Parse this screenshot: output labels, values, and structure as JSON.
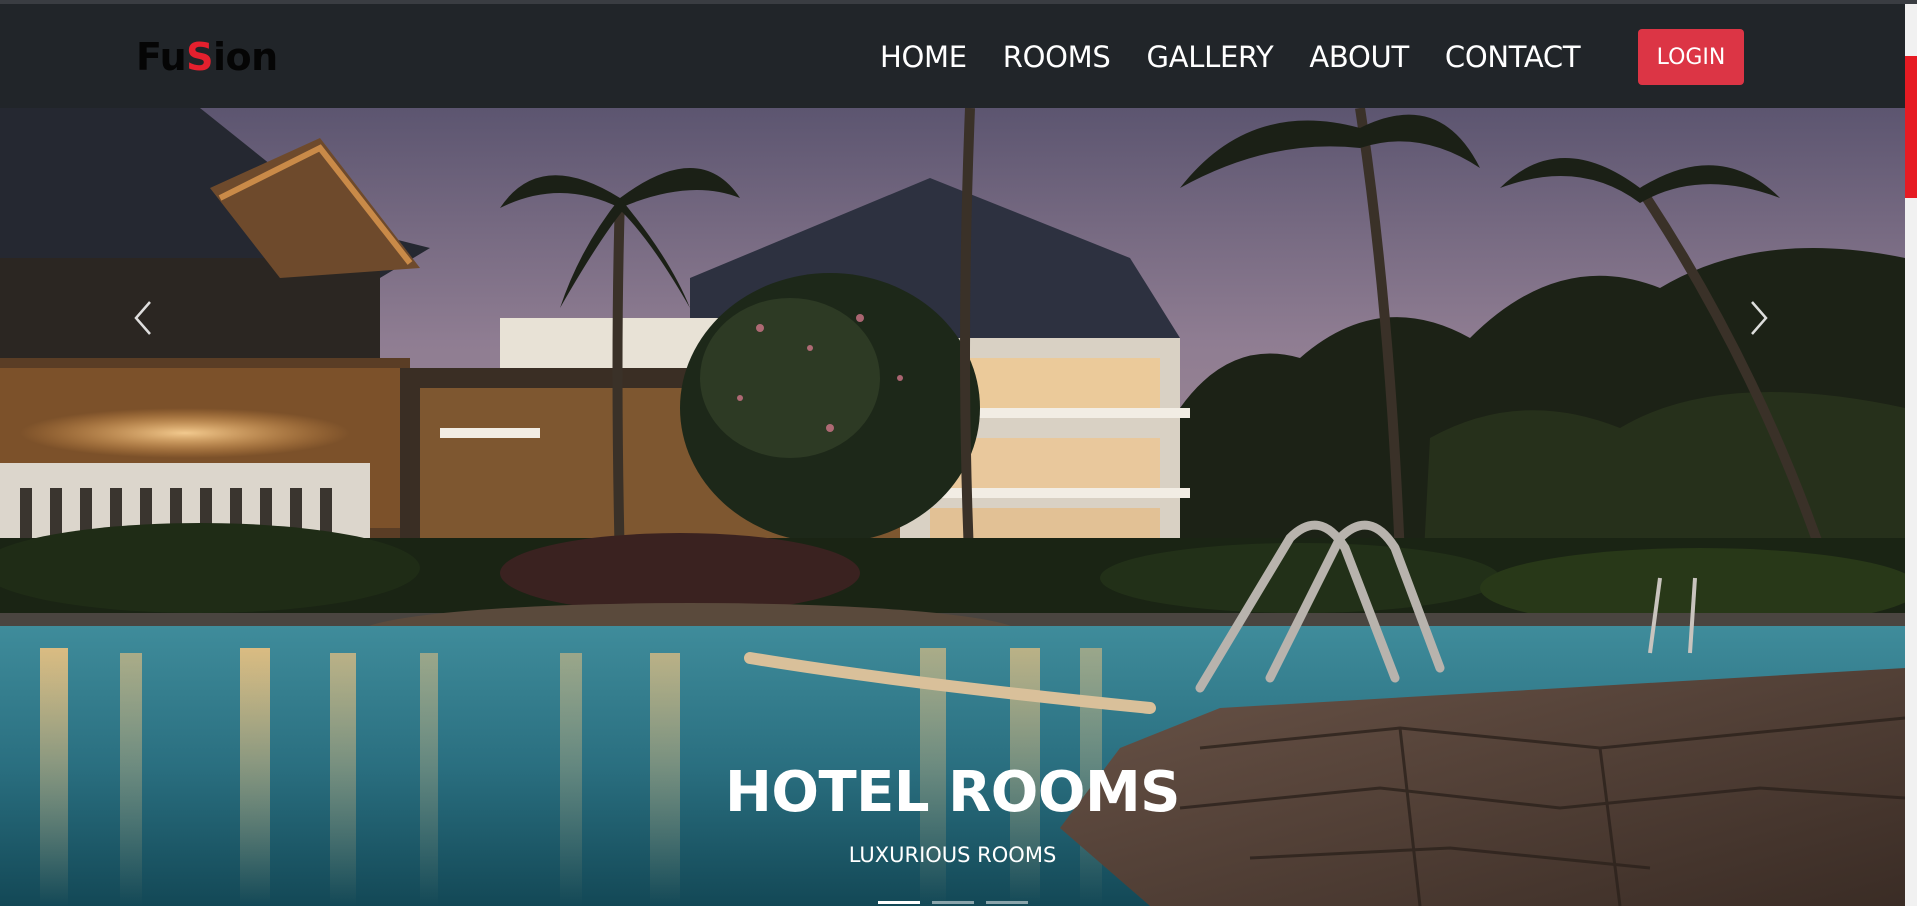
{
  "brand": {
    "prefix": "Fu",
    "accent_letter": "S",
    "suffix": "ion",
    "accent_color": "#e5202e"
  },
  "nav": {
    "links": [
      "HOME",
      "ROOMS",
      "GALLERY",
      "ABOUT",
      "CONTACT"
    ],
    "login_label": "LOGIN",
    "login_color": "#dc3545",
    "background": "#212529"
  },
  "carousel": {
    "caption_title": "HOTEL ROOMS",
    "caption_subtitle": "LUXURIOUS ROOMS",
    "prev_icon": "chevron-left-icon",
    "next_icon": "chevron-right-icon",
    "slide_count": 3,
    "active_slide": 1
  },
  "scrollbar": {
    "thumb_color": "#e61b23"
  }
}
